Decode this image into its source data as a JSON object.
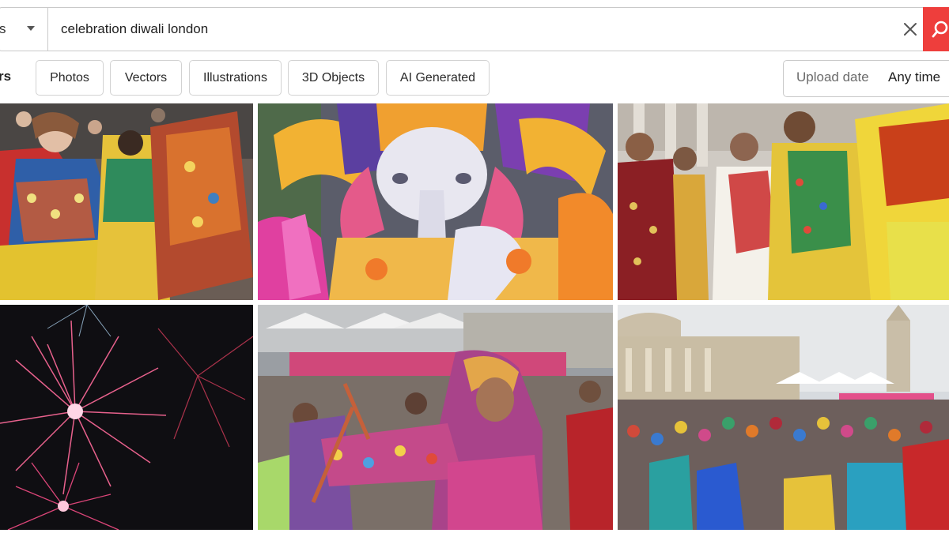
{
  "search": {
    "type_selector": "s",
    "query": "celebration diwali london",
    "clear_icon": "close-icon",
    "submit_icon": "search-icon"
  },
  "filters": {
    "label": "rs",
    "chips": [
      "Photos",
      "Vectors",
      "Illustrations",
      "3D Objects",
      "AI Generated"
    ],
    "upload_date": {
      "label": "Upload date",
      "value": "Any time"
    }
  },
  "results": {
    "tiles": [
      {
        "subject": "dancers in colourful garba costumes"
      },
      {
        "subject": "Ganesha lantern sculpture"
      },
      {
        "subject": "women and men in traditional dress at Trafalgar Square"
      },
      {
        "subject": "pink fireworks on dark sky"
      },
      {
        "subject": "dancer with dandiya sticks"
      },
      {
        "subject": "crowd at Trafalgar Square"
      }
    ]
  },
  "colors": {
    "accent": "#ee3e3c",
    "border": "#c9c9c9"
  }
}
